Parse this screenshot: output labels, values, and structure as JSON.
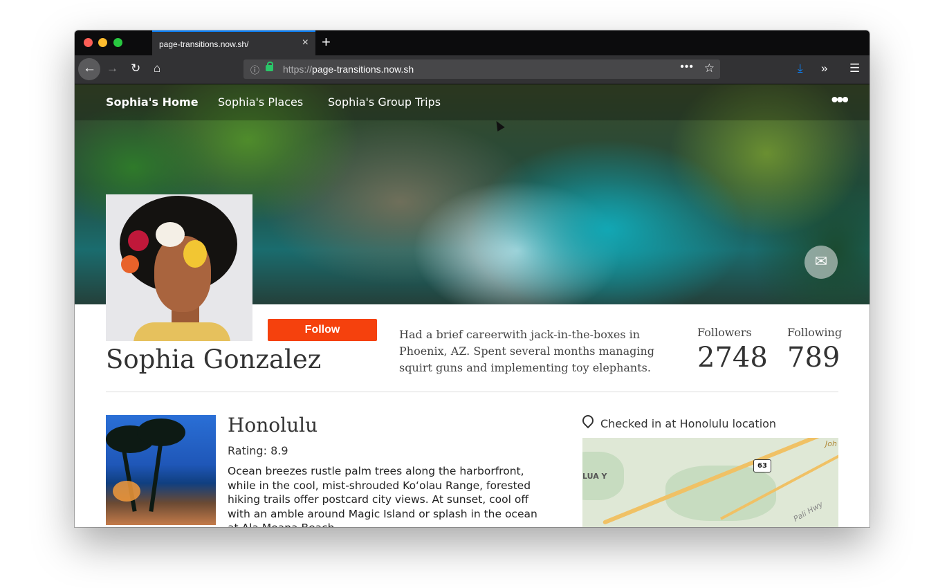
{
  "browser": {
    "tab_title": "page-transitions.now.sh/",
    "tab_close": "×",
    "new_tab": "+",
    "url_prefix": "https://",
    "url_host": "page-transitions.now.sh",
    "icons": {
      "back": "←",
      "forward": "→",
      "reload": "↻",
      "home": "⌂",
      "info": "ⓘ",
      "page_actions": "•••",
      "bookmark": "☆",
      "downloads": "⤓",
      "overflow": "»",
      "menu": "☰"
    },
    "colors": {
      "accent": "#0a84ff",
      "download_icon": "#0a84ff"
    }
  },
  "nav": {
    "home": "Sophia's Home",
    "places": "Sophia's Places",
    "group_trips": "Sophia's Group Trips",
    "more": "•••"
  },
  "profile": {
    "name": "Sophia Gonzalez",
    "follow_label": "Follow",
    "bio": "Had a brief careerwith jack-in-the-boxes in Phoenix, AZ. Spent several months managing squirt guns and implementing toy elephants.",
    "followers_label": "Followers",
    "followers_count": "2748",
    "following_label": "Following",
    "following_count": "789",
    "mail_icon": "✉",
    "colors": {
      "follow_button": "#f5410d"
    }
  },
  "place": {
    "title": "Honolulu",
    "rating_label": "Rating: 8.9",
    "description": "Ocean breezes rustle palm trees along the harborfront, while in the cool, mist-shrouded Koʻolau Range, forested hiking trails offer postcard city views. At sunset, cool off with an amble around Magic Island or splash in the ocean at Ala Moana Beach.",
    "checkin_text": "Checked in at Honolulu location",
    "map": {
      "route_shield": "63",
      "label_left": "LUA Y",
      "label_top_right": "Joh",
      "label_road": "Pali Hwy"
    }
  }
}
